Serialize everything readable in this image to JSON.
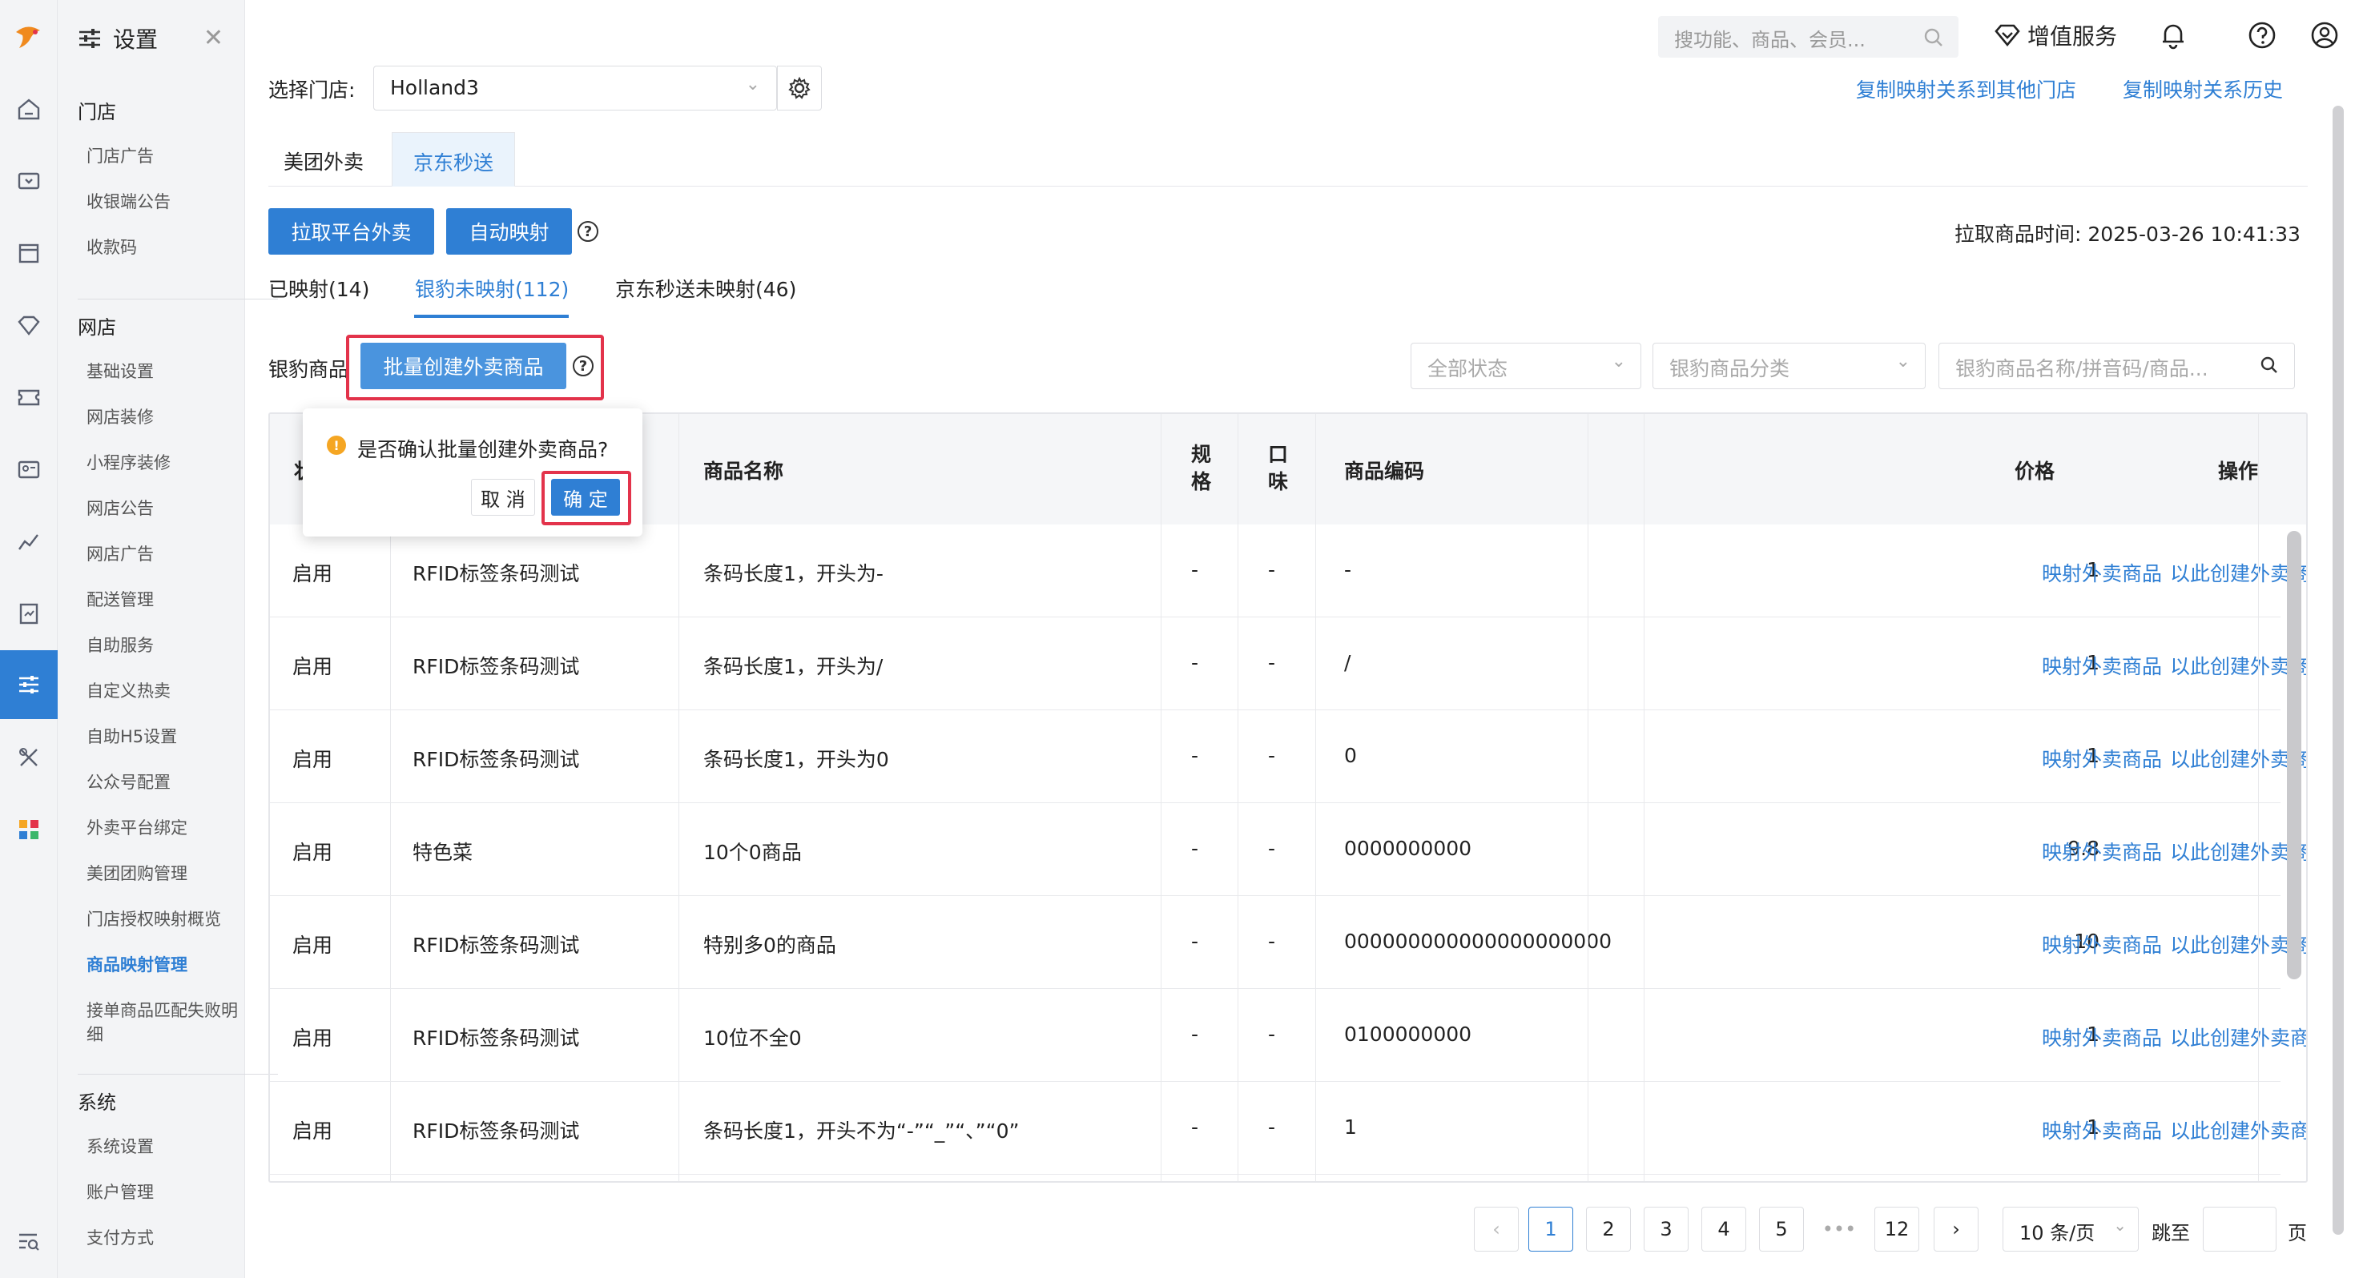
{
  "sidebar": {
    "title": "设置",
    "groups": [
      {
        "label": "门店",
        "items": [
          "门店广告",
          "收银端公告",
          "收款码"
        ]
      },
      {
        "label": "网店",
        "items": [
          "基础设置",
          "网店装修",
          "小程序装修",
          "网店公告",
          "网店广告",
          "配送管理",
          "自助服务",
          "自定义热卖",
          "自助H5设置",
          "公众号配置",
          "外卖平台绑定",
          "美团团购管理",
          "门店授权映射概览",
          "商品映射管理",
          "接单商品匹配失败明细"
        ]
      },
      {
        "label": "系统",
        "items": [
          "系统设置",
          "账户管理",
          "支付方式"
        ]
      }
    ],
    "active_item": "商品映射管理"
  },
  "topbar": {
    "search_placeholder": "搜功能、商品、会员...",
    "value_added": "增值服务"
  },
  "store": {
    "label": "选择门店:",
    "value": "Holland3",
    "copy_link": "复制映射关系到其他门店",
    "history_link": "复制映射关系历史"
  },
  "platform_tabs": [
    "美团外卖",
    "京东秒送"
  ],
  "active_platform": "京东秒送",
  "actions": {
    "pull": "拉取平台外卖",
    "auto_map": "自动映射",
    "pull_time_label": "拉取商品时间:",
    "pull_time": "2025-03-26 10:41:33"
  },
  "sub_tabs": [
    "已映射(14)",
    "银豹未映射(112)",
    "京东秒送未映射(46)"
  ],
  "active_sub_tab": "银豹未映射(112)",
  "filter": {
    "label": "银豹商品",
    "batch_button": "批量创建外卖商品",
    "status_placeholder": "全部状态",
    "category_placeholder": "银豹商品分类",
    "search_placeholder": "银豹商品名称/拼音码/商品..."
  },
  "popconfirm": {
    "message": "是否确认批量创建外卖商品?",
    "cancel": "取 消",
    "confirm": "确 定"
  },
  "table": {
    "headers": {
      "status": "状",
      "name": "商品名称",
      "spec": "规格",
      "taste": "口味",
      "code": "商品编码",
      "price": "价格",
      "ops": "操作"
    },
    "rows": [
      {
        "status": "启用",
        "category": "RFID标签条码测试",
        "name": "条码长度1，开头为-",
        "spec": "-",
        "taste": "-",
        "code": "-",
        "price": "1"
      },
      {
        "status": "启用",
        "category": "RFID标签条码测试",
        "name": "条码长度1，开头为/",
        "spec": "-",
        "taste": "-",
        "code": "/",
        "price": "1"
      },
      {
        "status": "启用",
        "category": "RFID标签条码测试",
        "name": "条码长度1，开头为0",
        "spec": "-",
        "taste": "-",
        "code": "0",
        "price": "1"
      },
      {
        "status": "启用",
        "category": "特色菜",
        "name": "10个0商品",
        "spec": "-",
        "taste": "-",
        "code": "0000000000",
        "price": "9.8"
      },
      {
        "status": "启用",
        "category": "RFID标签条码测试",
        "name": "特别多0的商品",
        "spec": "-",
        "taste": "-",
        "code": "000000000000000000000",
        "price": "10"
      },
      {
        "status": "启用",
        "category": "RFID标签条码测试",
        "name": "10位不全0",
        "spec": "-",
        "taste": "-",
        "code": "0100000000",
        "price": "1"
      },
      {
        "status": "启用",
        "category": "RFID标签条码测试",
        "name": "条码长度1，开头不为“-”“_”“、”“0”",
        "spec": "-",
        "taste": "-",
        "code": "1",
        "price": "1"
      }
    ],
    "op_map": "映射外卖商品",
    "op_create": "以此创建外卖商品"
  },
  "pagination": {
    "pages": [
      "1",
      "2",
      "3",
      "4",
      "5",
      "•••",
      "12"
    ],
    "current": "1",
    "page_size": "10 条/页",
    "jump_label": "跳至",
    "page_suffix": "页"
  },
  "colors": {
    "primary": "#2f7fd4",
    "highlight": "#e3334b",
    "warning": "#f5a623"
  }
}
